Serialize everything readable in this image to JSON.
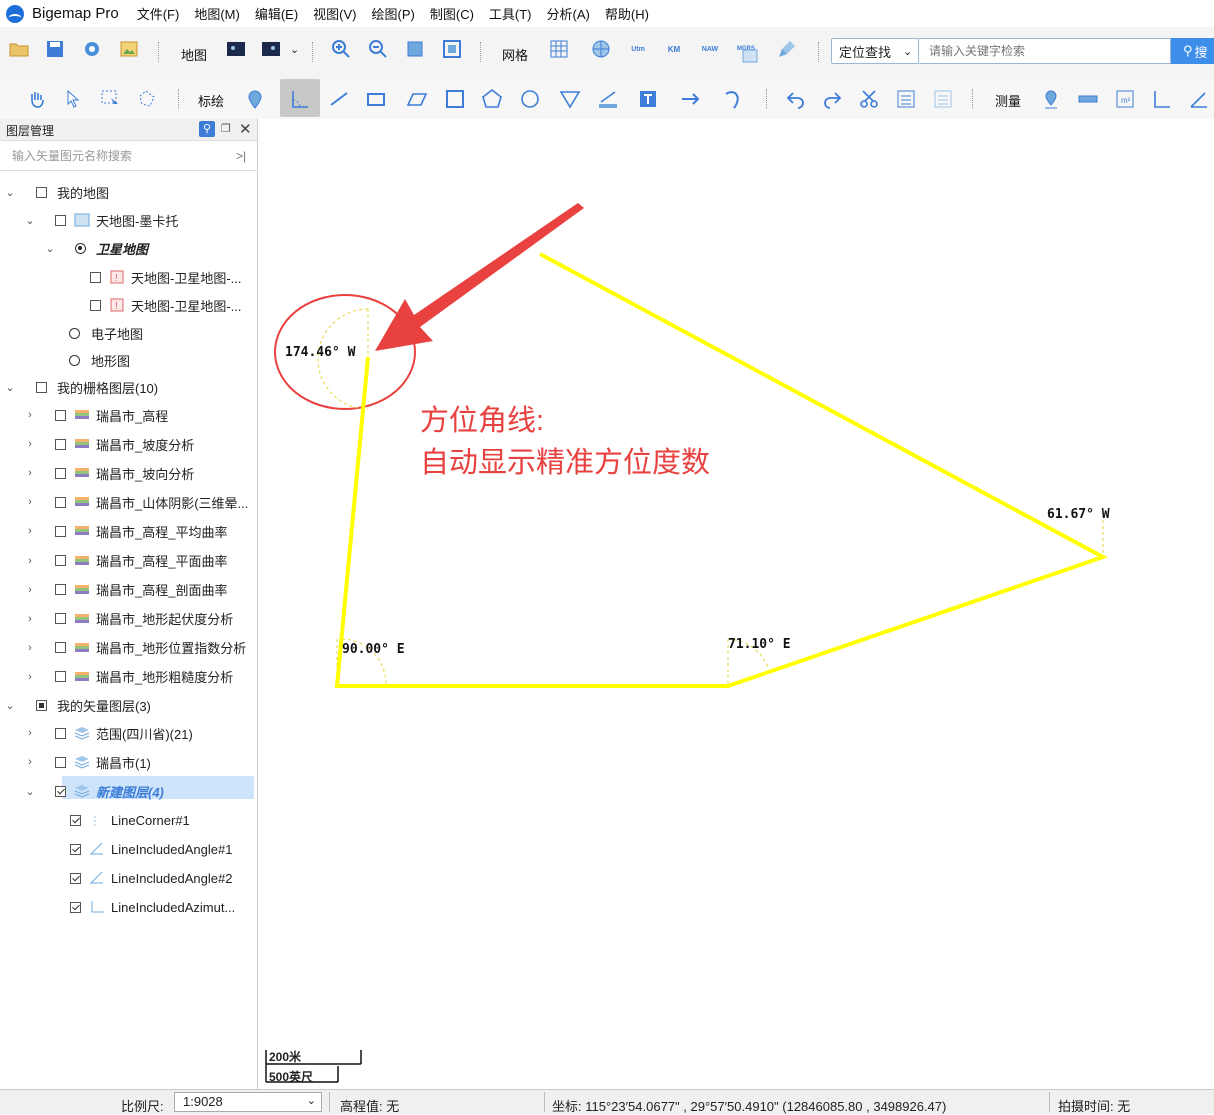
{
  "app": {
    "name": "Bigemap Pro"
  },
  "menu": [
    "文件(F)",
    "地图(M)",
    "编辑(E)",
    "视图(V)",
    "绘图(P)",
    "制图(C)",
    "工具(T)",
    "分析(A)",
    "帮助(H)"
  ],
  "toolbar1": {
    "map_label": "地图",
    "grid_label": "网格",
    "grid_buttons": [
      "Utm",
      "KM",
      "NAW",
      "MGRS"
    ],
    "search_type": "定位查找",
    "search_placeholder": "请输入关键字检索",
    "search_button": "搜"
  },
  "toolbar2": {
    "annotate_label": "标绘",
    "measure_label": "测量"
  },
  "layer_panel": {
    "title": "图层管理",
    "search_placeholder": "输入矢量图元名称搜索",
    "my_map": "我的地图",
    "tianditu_mercator": "天地图-墨卡托",
    "satellite_map": "卫星地图",
    "sat_layer_1": "天地图-卫星地图-...",
    "sat_layer_2": "天地图-卫星地图-...",
    "electronic_map": "电子地图",
    "terrain_map": "地形图",
    "raster_group": "我的栅格图层(10)",
    "raster_layers": [
      "瑞昌市_高程",
      "瑞昌市_坡度分析",
      "瑞昌市_坡向分析",
      "瑞昌市_山体阴影(三维晕...",
      "瑞昌市_高程_平均曲率",
      "瑞昌市_高程_平面曲率",
      "瑞昌市_高程_剖面曲率",
      "瑞昌市_地形起伏度分析",
      "瑞昌市_地形位置指数分析",
      "瑞昌市_地形粗糙度分析"
    ],
    "vector_group": "我的矢量图层(3)",
    "vector_layers": [
      "范围(四川省)(21)",
      "瑞昌市(1)",
      "新建图层(4)"
    ],
    "features": [
      "LineCorner#1",
      "LineIncludedAngle#1",
      "LineIncludedAngle#2",
      "LineIncludedAzimut..."
    ]
  },
  "map": {
    "annotation_line1": "方位角线:",
    "annotation_line2": "自动显示精准方位度数",
    "labels": [
      "174.46° W",
      "61.67° W",
      "90.00° E",
      "71.10° E"
    ],
    "line_color": "#ffff00",
    "arrow_color": "#e8413f",
    "scale_metric": "200米",
    "scale_imperial": "500英尺"
  },
  "status": {
    "scale_label": "比例尺:",
    "scale_value": "1:9028",
    "elevation": "高程值: 无",
    "coords": "坐标:  115°23′54.0677\" , 29°57′50.4910\"   (12846085.80 , 3498926.47)",
    "capture_time": "拍摄时间: 无"
  }
}
